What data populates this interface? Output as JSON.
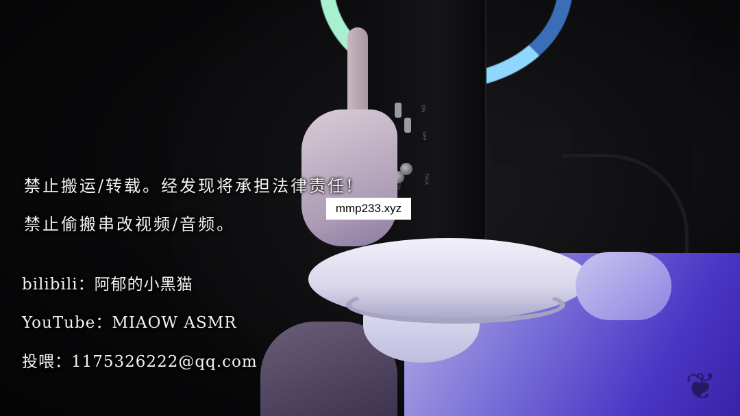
{
  "overlay": {
    "warning_line1": "禁止搬运/转载。经发现将承担法律责任!",
    "warning_line2": "禁止偷搬串改视频/音频。",
    "bilibili": "bilibili：阿郁的小黑猫",
    "youtube": "YouTube：MIAOW ASMR",
    "email": "投喂：1175326222@qq.com"
  },
  "watermark": "mmp233.xyz",
  "device_labels": [
    "ON",
    "OFF",
    "ON",
    "ON",
    "TALK",
    "OFF"
  ],
  "colors": {
    "headband_glow": "#8fd7ff",
    "hand_glow": "#4a36c4",
    "text": "#f4f4f4"
  }
}
